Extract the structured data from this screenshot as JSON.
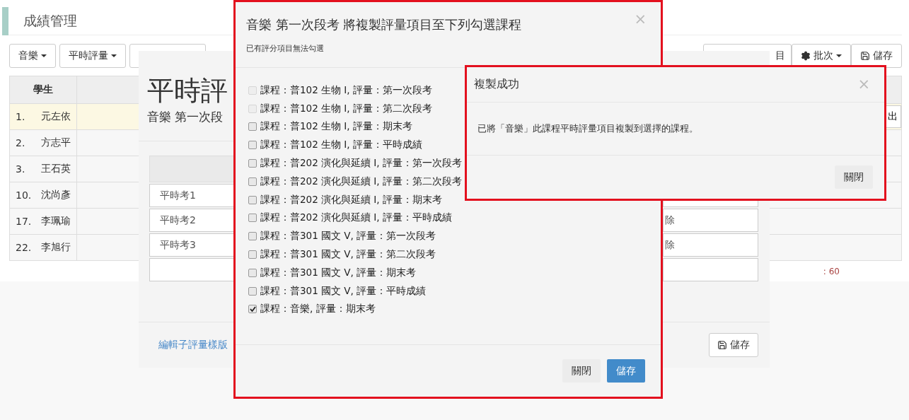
{
  "page": {
    "title": "成績管理",
    "toolbar_left": [
      {
        "label": "音樂"
      },
      {
        "label": "平時評量"
      }
    ],
    "toolbar_right": [
      {
        "kind": "plain",
        "label": "目"
      },
      {
        "kind": "menu",
        "label": "批次"
      },
      {
        "kind": "save",
        "label": "儲存"
      }
    ],
    "table": {
      "columns": [
        "學生"
      ],
      "side_button": "出",
      "rows": [
        {
          "number": "1.",
          "name": "元左依",
          "selected": true
        },
        {
          "number": "2.",
          "name": "方志平",
          "selected": false
        },
        {
          "number": "3.",
          "name": "王石英",
          "selected": false
        },
        {
          "number": "10.",
          "name": "沈尚彥",
          "selected": false
        },
        {
          "number": "17.",
          "name": "李珮瑜",
          "selected": false
        },
        {
          "number": "22.",
          "name": "李旭行",
          "selected": false
        }
      ]
    },
    "note": ": 60"
  },
  "item_dialog": {
    "title": "平時評",
    "subtitle": "音樂 第一次段",
    "rows": [
      {
        "value": "平時考1"
      },
      {
        "value": "平時考2",
        "action": "除"
      },
      {
        "value": "平時考3",
        "action": "除"
      },
      {}
    ],
    "template_link": "編輯子評量樣版",
    "save": "儲存"
  },
  "copy_dialog": {
    "title": "音樂 第一次段考 將複製評量項目至下列勾選課程",
    "subtitle": "已有評分項目無法勾選",
    "close": "×",
    "courses": [
      {
        "label": "課程：普102 生物 I, 評量：第一次段考",
        "checked": false,
        "disabled": true
      },
      {
        "label": "課程：普102 生物 I, 評量：第二次段考",
        "checked": false,
        "disabled": true
      },
      {
        "label": "課程：普102 生物 I, 評量：期末考",
        "checked": false,
        "disabled": false
      },
      {
        "label": "課程：普102 生物 I, 評量：平時成績",
        "checked": false,
        "disabled": false
      },
      {
        "label": "課程：普202 演化與延續 I, 評量：第一次段考",
        "checked": false,
        "disabled": false
      },
      {
        "label": "課程：普202 演化與延續 I, 評量：第二次段考",
        "checked": false,
        "disabled": false
      },
      {
        "label": "課程：普202 演化與延續 I, 評量：期末考",
        "checked": false,
        "disabled": false
      },
      {
        "label": "課程：普202 演化與延續 I, 評量：平時成績",
        "checked": false,
        "disabled": false
      },
      {
        "label": "課程：普301 國文 V, 評量：第一次段考",
        "checked": false,
        "disabled": false
      },
      {
        "label": "課程：普301 國文 V, 評量：第二次段考",
        "checked": false,
        "disabled": false
      },
      {
        "label": "課程：普301 國文 V, 評量：期末考",
        "checked": false,
        "disabled": false
      },
      {
        "label": "課程：普301 國文 V, 評量：平時成績",
        "checked": false,
        "disabled": false
      },
      {
        "label": "課程：音樂, 評量：期末考",
        "checked": true,
        "disabled": false
      }
    ],
    "buttons": {
      "close": "關閉",
      "save": "儲存"
    }
  },
  "success_dialog": {
    "title": "複製成功",
    "close": "×",
    "message": "已將「音樂」此課程平時評量項目複製到選擇的課程。",
    "button": "關閉"
  }
}
